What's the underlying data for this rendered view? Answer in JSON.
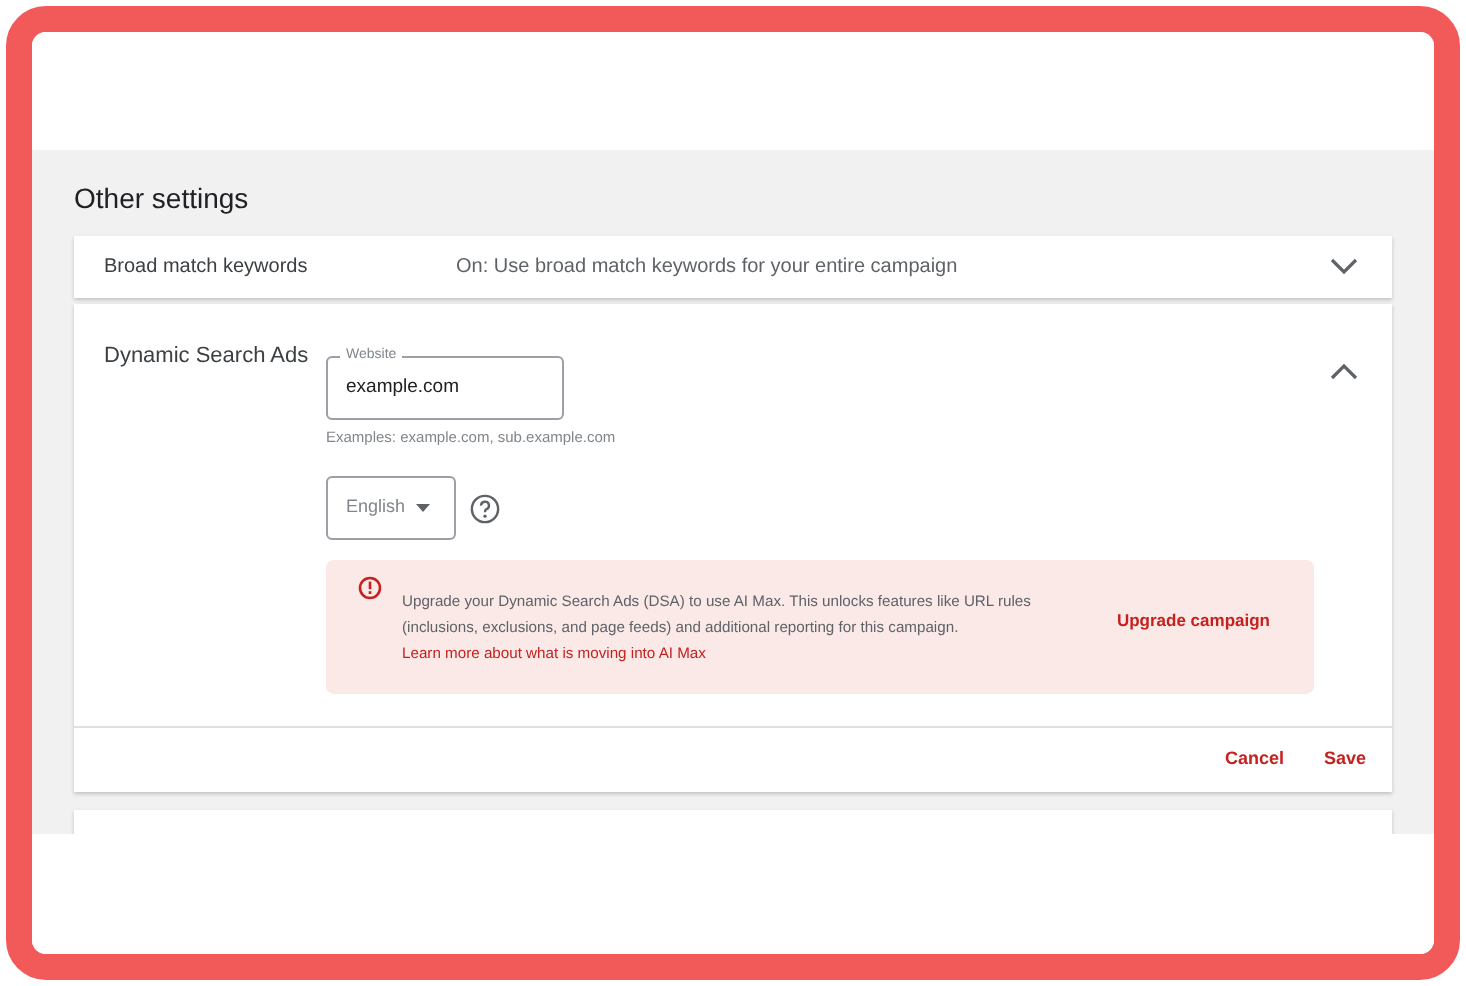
{
  "heading": "Other settings",
  "sections": [
    {
      "title": "Broad match keywords",
      "summary": "On: Use broad match keywords for your entire campaign",
      "expanded": false
    },
    {
      "title": "Dynamic Search Ads",
      "expanded": true,
      "website": {
        "label": "Website",
        "value": "example.com",
        "hint": "Examples: example.com, sub.example.com"
      },
      "language": {
        "value": "English"
      },
      "notice": {
        "text": "Upgrade your Dynamic Search Ads (DSA) to use AI Max. This unlocks features like URL rules (inclusions, exclusions, and page feeds) and additional reporting for this campaign.",
        "link": "Learn more about what is moving into AI Max",
        "action": "Upgrade campaign"
      },
      "buttons": [
        "Cancel",
        "Save"
      ]
    }
  ]
}
